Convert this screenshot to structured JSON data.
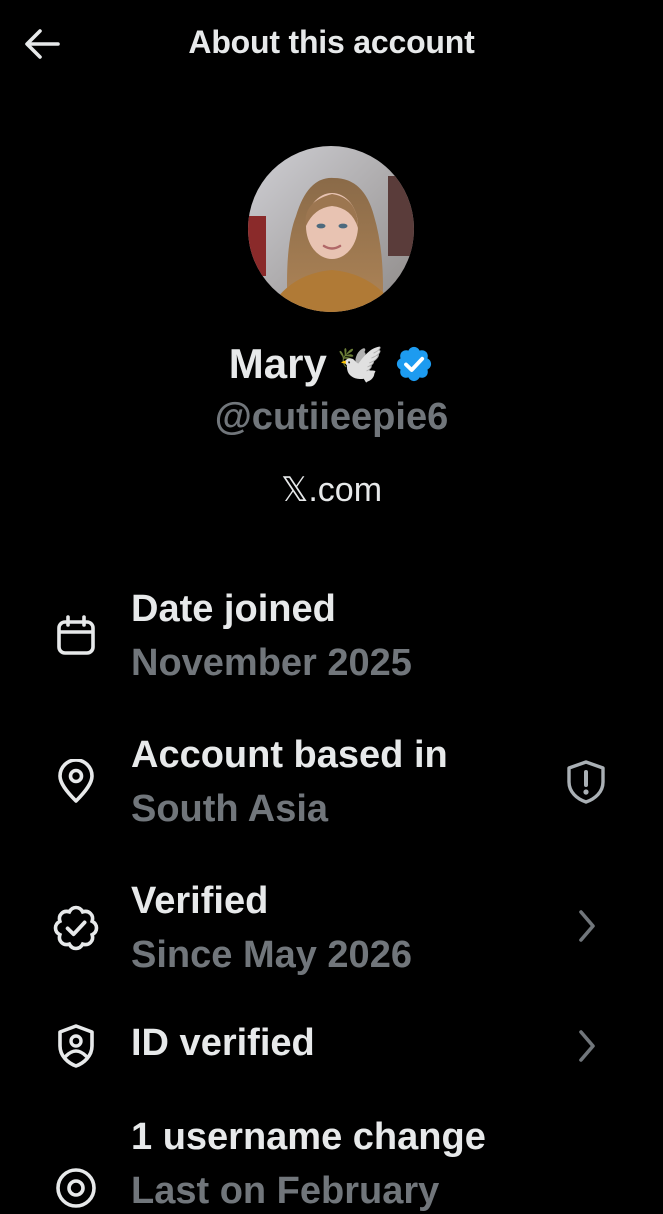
{
  "header": {
    "title": "About this account",
    "back_icon": "arrow-left-icon"
  },
  "profile": {
    "display_name": "Mary",
    "name_emoji": "🕊️",
    "verified_badge_color": "#1d9bf0",
    "handle": "@cutiieepie6",
    "website": "𝕏.com"
  },
  "rows": [
    {
      "title": "Date joined",
      "subtitle": "November 2025",
      "icon": "calendar-icon",
      "trailing": ""
    },
    {
      "title": "Account based in",
      "subtitle": "South Asia",
      "icon": "location-pin-icon",
      "trailing": "shield-alert-icon"
    },
    {
      "title": "Verified",
      "subtitle": "Since May 2026",
      "icon": "verified-badge-outline-icon",
      "trailing": "chevron-right-icon"
    },
    {
      "title": "ID verified",
      "subtitle": "",
      "icon": "id-shield-icon",
      "trailing": "chevron-right-icon"
    },
    {
      "title": "1 username change",
      "subtitle": "Last on February",
      "icon": "at-sign-icon",
      "trailing": ""
    }
  ],
  "colors": {
    "background": "#000000",
    "primary_text": "#e7e9ea",
    "secondary_text": "#71767b",
    "accent": "#1d9bf0"
  }
}
